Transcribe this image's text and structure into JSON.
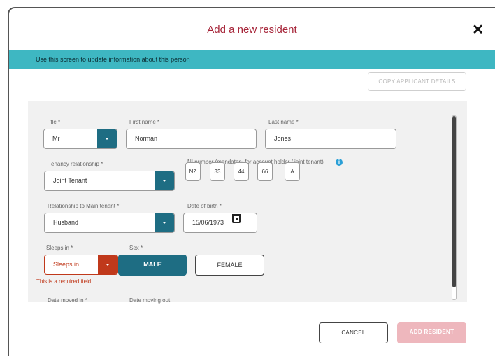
{
  "dialog": {
    "title": "Add a new resident",
    "close_label": "✕",
    "banner_text": "Use this screen to update information about this person",
    "copy_button_label": "COPY APPLICANT DETAILS"
  },
  "form": {
    "title": {
      "label": "Title *",
      "value": "Mr"
    },
    "first_name": {
      "label": "First name *",
      "value": "Norman"
    },
    "last_name": {
      "label": "Last name *",
      "value": "Jones"
    },
    "tenancy_relationship": {
      "label": "Tenancy relationship *",
      "value": "Joint Tenant"
    },
    "ni_number": {
      "label": "NI number (mandatory for account holder / joint tenant)",
      "info_icon": "i",
      "parts": [
        "NZ",
        "33",
        "44",
        "66",
        "A"
      ]
    },
    "relationship_to_main": {
      "label": "Relationship to Main tenant *",
      "value": "Husband"
    },
    "dob": {
      "label": "Date of birth *",
      "value": "15/06/1973"
    },
    "sleeps_in": {
      "label": "Sleeps in *",
      "value": "Sleeps in",
      "error": "This is a required field"
    },
    "sex": {
      "label": "Sex *",
      "options": [
        "MALE",
        "FEMALE"
      ],
      "selected": "MALE"
    },
    "date_moved_in": {
      "label": "Date moved in *"
    },
    "date_moving_out": {
      "label": "Date moving out"
    }
  },
  "footer": {
    "cancel_label": "CANCEL",
    "add_label": "ADD RESIDENT"
  },
  "colors": {
    "accent": "#1e6d83",
    "banner": "#3eb7c2",
    "title": "#a7263a",
    "error": "#c0391b"
  }
}
